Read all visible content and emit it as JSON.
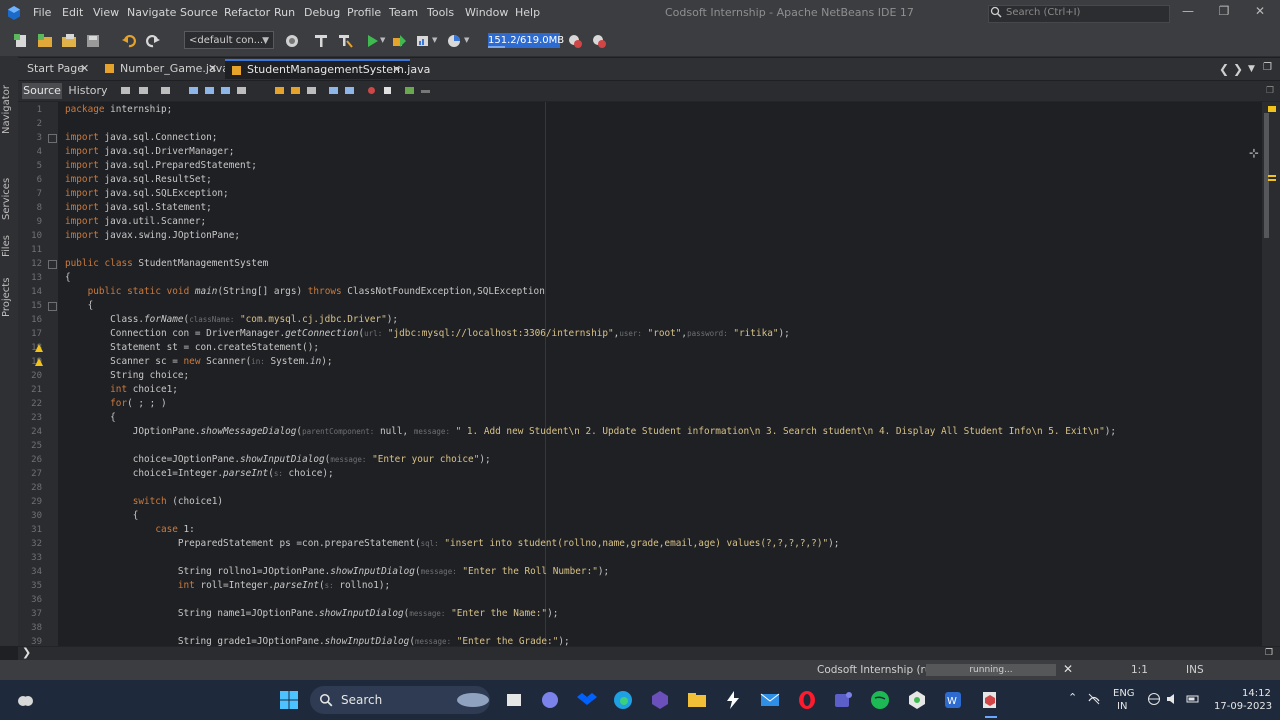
{
  "window": {
    "title": "Codsoft Internship - Apache NetBeans IDE 17",
    "search_placeholder": "Search (Ctrl+I)",
    "app_icon": "netbeans-icon"
  },
  "menu": [
    "File",
    "Edit",
    "View",
    "Navigate",
    "Source",
    "Refactor",
    "Run",
    "Debug",
    "Profile",
    "Team",
    "Tools",
    "Window",
    "Help"
  ],
  "toolbar": {
    "config": "<default con...",
    "memory": "151.2/619.0MB",
    "memory_used_fraction": 0.24
  },
  "side_tabs": [
    "Navigator",
    "Services",
    "Files",
    "Projects"
  ],
  "tabs": [
    {
      "label": "Start Page",
      "active": false
    },
    {
      "label": "Number_Game.java",
      "active": false
    },
    {
      "label": "StudentManagementSystem.java",
      "active": true
    }
  ],
  "editor_toolbar": {
    "source": "Source",
    "history": "History"
  },
  "code_lines": [
    "package internship;",
    "",
    "import java.sql.Connection;",
    "import java.sql.DriverManager;",
    "import java.sql.PreparedStatement;",
    "import java.sql.ResultSet;",
    "import java.sql.SQLException;",
    "import java.sql.Statement;",
    "import java.util.Scanner;",
    "import javax.swing.JOptionPane;",
    "",
    "public class StudentManagementSystem",
    "{",
    "    public static void main(String[] args) throws ClassNotFoundException,SQLException",
    "    {",
    "        Class.forName(className: \"com.mysql.cj.jdbc.Driver\");",
    "        Connection con = DriverManager.getConnection(url: \"jdbc:mysql://localhost:3306/internship\",user: \"root\",password: \"ritika\");",
    "        Statement st = con.createStatement();",
    "        Scanner sc = new Scanner(in: System.in);",
    "        String choice;",
    "        int choice1;",
    "        for( ; ; )",
    "        {",
    "            JOptionPane.showMessageDialog(parentComponent: null, message: \" 1. Add new Student\\n 2. Update Student information\\n 3. Search student\\n 4. Display All Student Info\\n 5. Exit\\n\");",
    "",
    "            choice=JOptionPane.showInputDialog(message: \"Enter your choice\");",
    "            choice1=Integer.parseInt(s: choice);",
    "",
    "            switch (choice1)",
    "            {",
    "                case 1:",
    "                    PreparedStatement ps =con.prepareStatement(sql: \"insert into student(rollno,name,grade,email,age) values(?,?,?,?,?)\");",
    "",
    "                    String rollno1=JOptionPane.showInputDialog(message: \"Enter the Roll Number:\");",
    "                    int roll=Integer.parseInt(s: rollno1);",
    "",
    "                    String name1=JOptionPane.showInputDialog(message: \"Enter the Name:\");",
    "",
    "                    String grade1=JOptionPane.showInputDialog(message: \"Enter the Grade:\");"
  ],
  "status": {
    "project": "Codsoft Internship (run)",
    "progress": "running...",
    "position": "1:1",
    "mode": "INS"
  },
  "taskbar": {
    "search": "Search",
    "lang1": "ENG",
    "lang2": "IN",
    "time": "14:12",
    "date": "17-09-2023",
    "apps": [
      "windows-start-icon",
      "search-icon",
      "file-explorer-icon",
      "chat-icon",
      "dropbox-icon",
      "edge-icon",
      "visual-studio-icon",
      "folder-icon",
      "power-automate-icon",
      "mail-icon",
      "opera-icon",
      "teams-icon",
      "spotify-icon",
      "git-icon",
      "whatsapp-icon",
      "netbeans-icon"
    ]
  }
}
